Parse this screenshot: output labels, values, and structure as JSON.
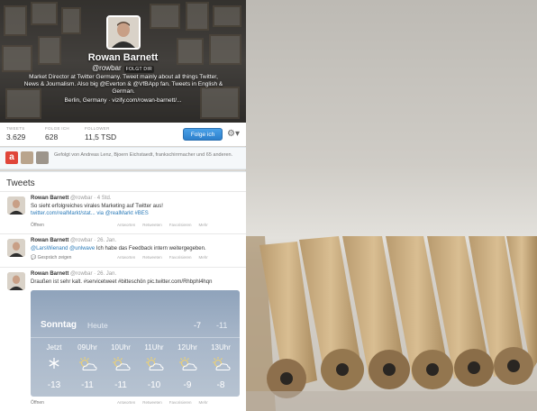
{
  "profile": {
    "name": "Rowan Barnett",
    "handle": "@rowbar",
    "follows_you": "FOLGT DIR",
    "bio": "Market Director at Twitter Germany. Tweet mainly about all things Twitter, News & Journalism. Also big @Everton & @VfBApp fan. Tweets in English & German.",
    "location": "Berlin, Germany · vizify.com/rowan-barnett/..."
  },
  "stats": [
    {
      "label": "TWEETS",
      "value": "3.629"
    },
    {
      "label": "FOLGE ICH",
      "value": "628"
    },
    {
      "label": "FOLLOWER",
      "value": "11,5 TSD"
    }
  ],
  "actions": {
    "follow_label": "Folge ich",
    "settings_icon": "gear-icon"
  },
  "followed_by": "Gefolgt von Andreas Lenz, Bjoern Eichstaedt, frankschirrmacher und 65 anderen.",
  "tweets_title": "Tweets",
  "tweets": [
    {
      "name": "Rowan Barnett",
      "handle": "@rowbar",
      "time": "· 4 Std.",
      "text": "So sieht erfolgreiches virales Marketing auf Twitter aus!",
      "link": "twitter.com/realMarkt/stat... via @realMarkt #BES",
      "meta": "Öffnen"
    },
    {
      "name": "Rowan Barnett",
      "handle": "@rowbar",
      "time": "· 26. Jan.",
      "text_mention": "@LarsWienand @unlwave",
      "text": " Ich habe das Feedback intern weitergegeben.",
      "meta": "Gespräch zeigen"
    },
    {
      "name": "Rowan Barnett",
      "handle": "@rowbar",
      "time": "· 26. Jan.",
      "text": "Draußen ist sehr kalt. #servicetweet #bitteschön pic.twitter.com/Rhbphl4hqn",
      "meta": "Öffnen"
    }
  ],
  "tweet_actions": [
    "Antworten",
    "Retweeten",
    "Favorisieren",
    "Mehr"
  ],
  "weather": {
    "day": "Sonntag",
    "sub": "Heute",
    "hi": "-7",
    "lo": "-11",
    "hours": [
      {
        "label": "Jetzt",
        "icon": "snow-icon",
        "temp": "-13"
      },
      {
        "label": "09Uhr",
        "icon": "partly-cloudy-icon",
        "temp": "-11"
      },
      {
        "label": "10Uhr",
        "icon": "partly-cloudy-icon",
        "temp": "-11"
      },
      {
        "label": "11Uhr",
        "icon": "partly-cloudy-icon",
        "temp": "-10"
      },
      {
        "label": "12Uhr",
        "icon": "partly-cloudy-icon",
        "temp": "-9"
      },
      {
        "label": "13Uhr",
        "icon": "partly-cloudy-icon",
        "temp": "-8"
      }
    ]
  },
  "colors": {
    "accent": "#2b7bb9",
    "follow_button": "#3a8fdb"
  }
}
